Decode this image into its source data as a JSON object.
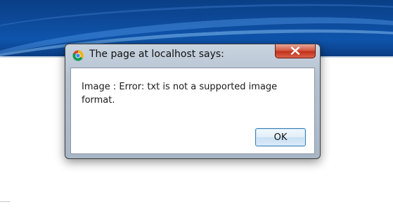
{
  "dialog": {
    "title": "The page at localhost says:",
    "message": "Image : Error: txt is not a supported image format.",
    "ok_label": "OK",
    "close_icon": "close-icon",
    "app_icon": "chrome-icon"
  },
  "colors": {
    "banner": "#0d4a9a",
    "close_button": "#c2301c",
    "ok_border": "#3c7fb1"
  }
}
